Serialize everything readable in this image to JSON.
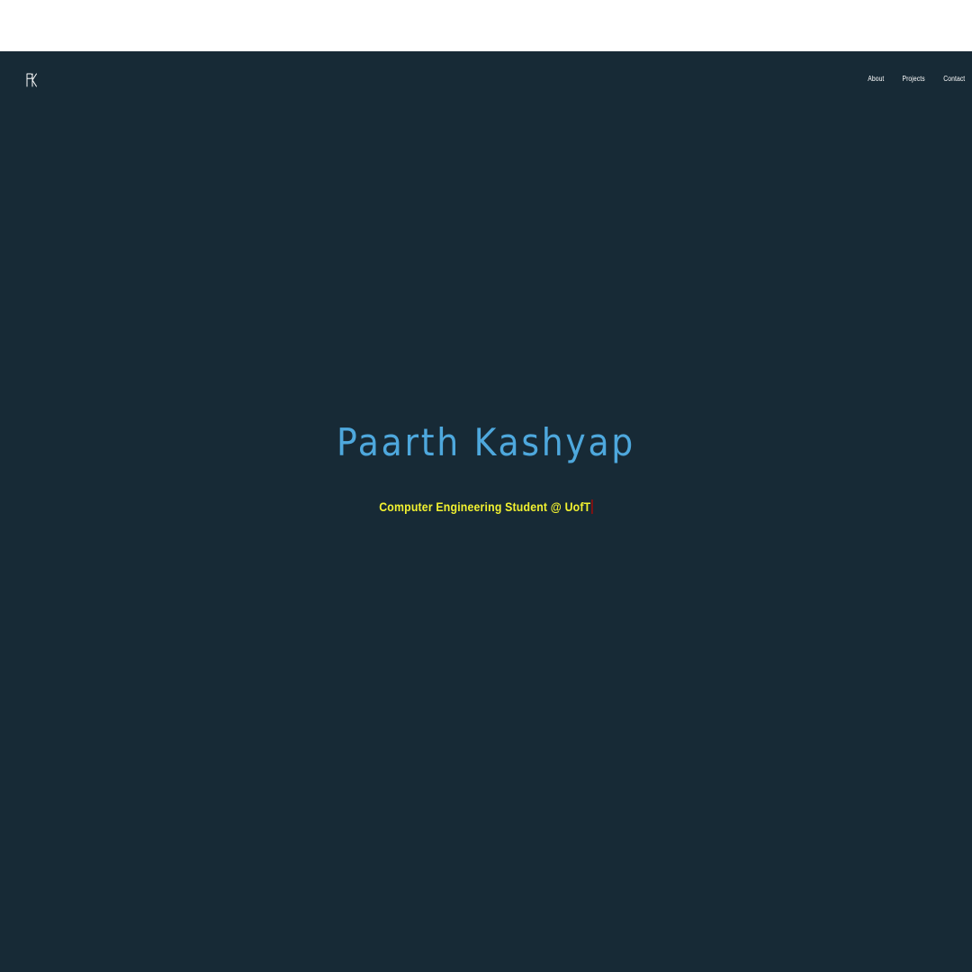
{
  "header": {
    "logo_text": "PK",
    "nav": [
      {
        "label": "About"
      },
      {
        "label": "Projects"
      },
      {
        "label": "Contact"
      }
    ]
  },
  "hero": {
    "name": "Paarth Kashyap",
    "tagline": "Computer Engineering Student @ UofT"
  },
  "colors": {
    "background": "#172a36",
    "name": "#4ea8dd",
    "tagline": "#f2f230",
    "cursor": "#8a1010",
    "nav_text": "#ffffff"
  }
}
